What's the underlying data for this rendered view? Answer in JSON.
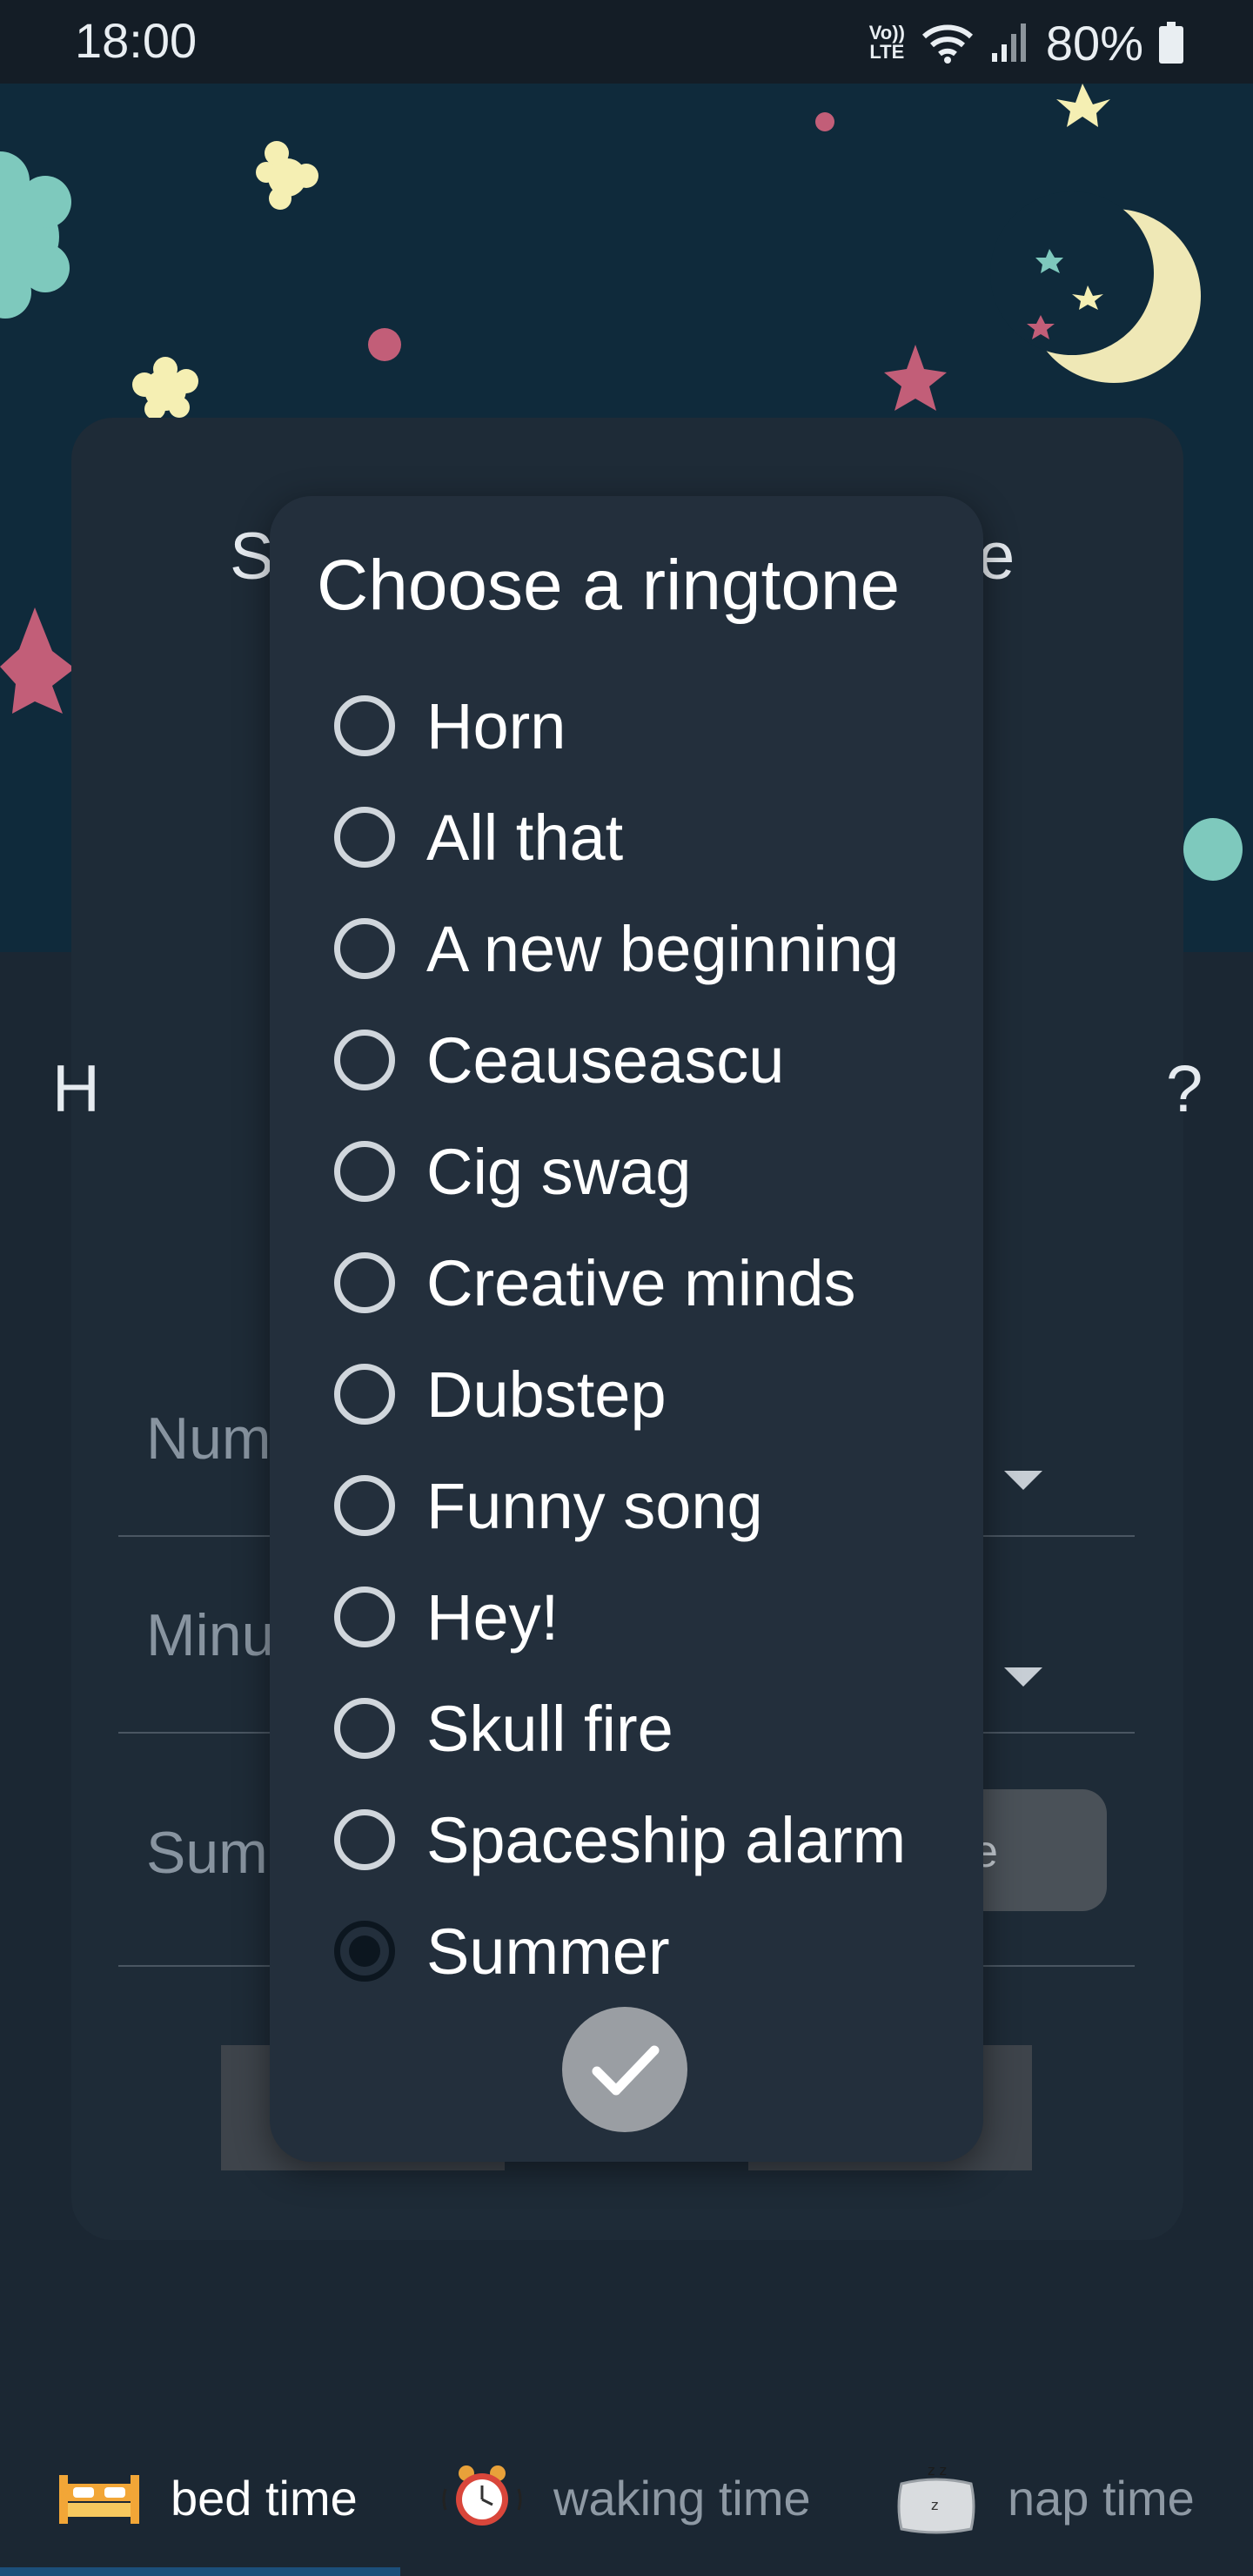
{
  "status_bar": {
    "time": "18:00",
    "network_label_top": "Vo))",
    "network_label_bottom": "LTE",
    "battery": "80%",
    "icons": [
      "wifi-icon",
      "signal-icon",
      "battery-icon"
    ]
  },
  "background": {
    "title_left_fragment": "S",
    "title_right_fragment": "e",
    "question_left_fragment": "H",
    "question_right_fragment": "?",
    "fields": [
      {
        "label_fragment": "Num"
      },
      {
        "label_fragment": "Minu"
      },
      {
        "label_fragment": "Sum"
      }
    ],
    "pill_text_fragment": "se"
  },
  "dialog": {
    "title": "Choose a ringtone",
    "ringtones": [
      {
        "label": "Horn",
        "selected": false
      },
      {
        "label": "All that",
        "selected": false
      },
      {
        "label": "A new beginning",
        "selected": false
      },
      {
        "label": "Ceauseascu",
        "selected": false
      },
      {
        "label": "Cig swag",
        "selected": false
      },
      {
        "label": "Creative minds",
        "selected": false
      },
      {
        "label": "Dubstep",
        "selected": false
      },
      {
        "label": "Funny song",
        "selected": false
      },
      {
        "label": "Hey!",
        "selected": false
      },
      {
        "label": "Skull fire",
        "selected": false
      },
      {
        "label": "Spaceship alarm",
        "selected": false
      },
      {
        "label": "Summer",
        "selected": true
      }
    ],
    "confirm_icon": "check-icon"
  },
  "bottom_nav": {
    "items": [
      {
        "label": "bed time",
        "icon": "bed-icon",
        "active": true
      },
      {
        "label": "waking time",
        "icon": "alarm-clock-icon",
        "active": false
      },
      {
        "label": "nap time",
        "icon": "pillow-icon",
        "active": false
      }
    ]
  },
  "colors": {
    "sky": "#0f2a3b",
    "card": "#1e2b37",
    "dialog": "#232f3c",
    "accent_active_nav": "#1c4f7a",
    "star_yellow": "#f5efb3",
    "star_teal": "#7ec9bd",
    "star_pink": "#c25e78"
  }
}
